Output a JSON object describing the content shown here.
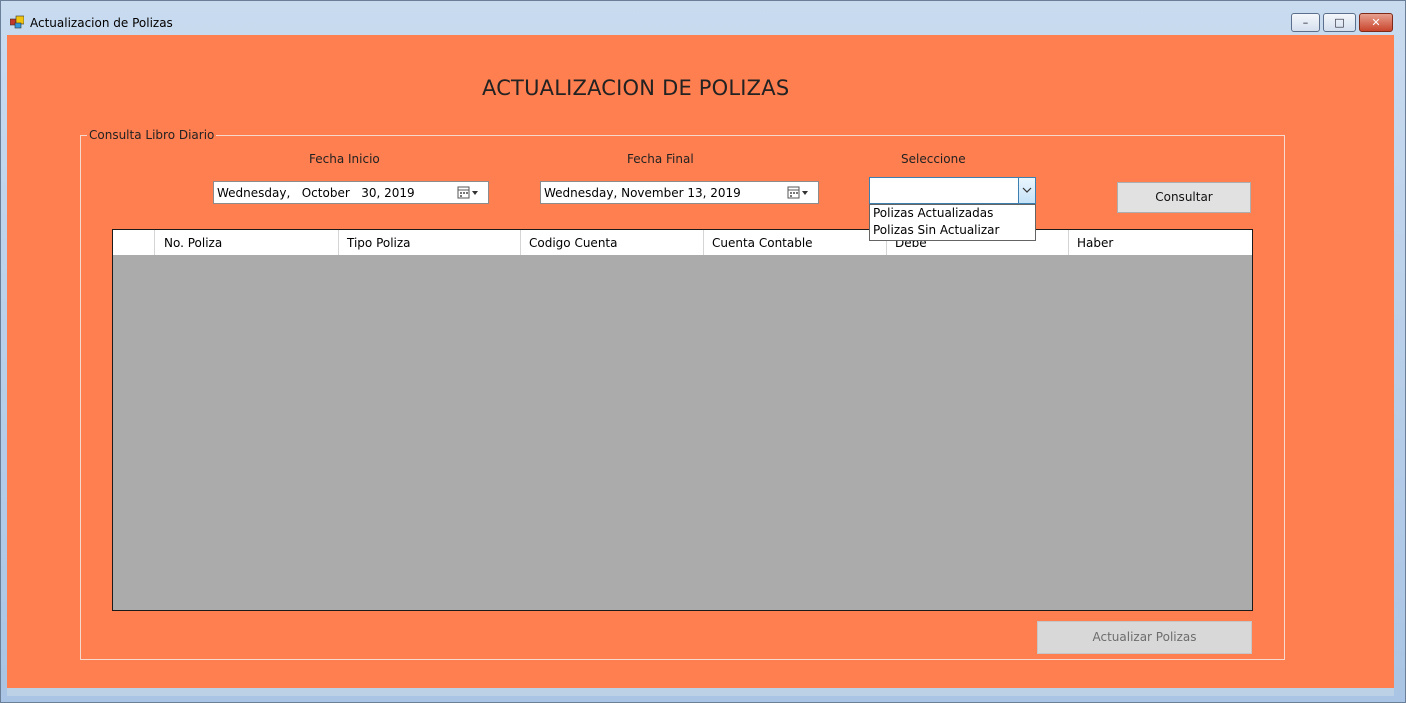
{
  "window": {
    "title": "Actualizacion de Polizas",
    "controls": {
      "minimize": "–",
      "maximize": "□",
      "close": "✕"
    }
  },
  "colors": {
    "form_background": "#ff7f50",
    "grid_background": "#ababab",
    "titlebar": "#bcd0e6"
  },
  "page_title": "ACTUALIZACION DE POLIZAS",
  "group": {
    "label": "Consulta Libro Diario",
    "fecha_inicio_label": "Fecha Inicio",
    "fecha_inicio_value": "Wednesday,   October   30, 2019",
    "fecha_final_label": "Fecha Final",
    "fecha_final_value": "Wednesday, November 13, 2019",
    "seleccione_label": "Seleccione",
    "combo_value": "",
    "combo_options": [
      "Polizas Actualizadas",
      "Polizas Sin Actualizar"
    ],
    "consultar_label": "Consultar",
    "actualizar_label": "Actualizar Polizas"
  },
  "grid": {
    "columns": [
      "No. Poliza",
      "Tipo Poliza",
      "Codigo Cuenta",
      "Cuenta Contable",
      "Debe",
      "Haber"
    ],
    "rows": []
  },
  "icons": [
    "app-icon",
    "calendar-dropdown-icon",
    "chevron-down-icon"
  ]
}
